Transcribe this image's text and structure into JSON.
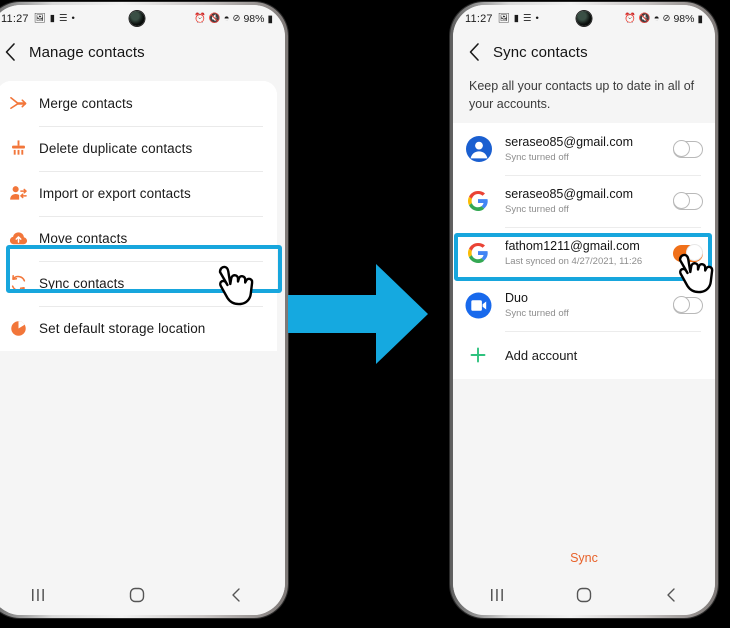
{
  "status_bar": {
    "time": "11:27",
    "left_icons": [
      "image-icon",
      "sim-icon",
      "mail-icon",
      "dot-icon"
    ],
    "right_icons": [
      "alarm-icon",
      "mute-icon",
      "wifi-icon",
      "dnd-icon"
    ],
    "battery_percent": "98%"
  },
  "colors": {
    "highlight": "#17a6dd",
    "accent_orange": "#f07019",
    "sync_text": "#e8622a",
    "toggle_off_border": "#b9b9b9",
    "add_plus_green": "#2ec27e"
  },
  "left_phone": {
    "appbar": {
      "title": "Manage contacts",
      "back_icon": "back-chevron-icon"
    },
    "menu_items": [
      {
        "label": "Merge contacts",
        "icon": "merge-arrows-icon"
      },
      {
        "label": "Delete duplicate contacts",
        "icon": "broom-icon"
      },
      {
        "label": "Import or export contacts",
        "icon": "person-transfer-icon"
      },
      {
        "label": "Move contacts",
        "icon": "cloud-upload-icon"
      },
      {
        "label": "Sync contacts",
        "icon": "sync-refresh-icon",
        "highlighted": true
      },
      {
        "label": "Set default storage location",
        "icon": "pie-storage-icon"
      }
    ],
    "nav_buttons": [
      "recents-icon",
      "home-icon",
      "back-icon"
    ]
  },
  "right_phone": {
    "appbar": {
      "title": "Sync contacts",
      "back_icon": "back-chevron-icon"
    },
    "description": "Keep all your contacts up to date in all of your accounts.",
    "accounts": [
      {
        "name": "seraseo85@gmail.com",
        "status": "Sync turned off",
        "icon": "samsung-account-icon",
        "toggle_on": false
      },
      {
        "name": "seraseo85@gmail.com",
        "status": "Sync turned off",
        "icon": "google-icon",
        "toggle_on": false
      },
      {
        "name": "fathom1211@gmail.com",
        "status": "Last synced on 4/27/2021, 11:26",
        "icon": "google-icon",
        "toggle_on": true,
        "highlighted": true
      },
      {
        "name": "Duo",
        "status": "Sync turned off",
        "icon": "duo-icon",
        "toggle_on": false
      }
    ],
    "add_account": {
      "label": "Add account",
      "icon": "plus-icon"
    },
    "sync_button": {
      "label": "Sync"
    },
    "nav_buttons": [
      "recents-icon",
      "home-icon",
      "back-icon"
    ]
  },
  "arrow": {
    "icon": "right-arrow-icon",
    "color": "#17a6dd"
  },
  "hand_cursor": {
    "icon": "tapping-hand-icon"
  }
}
